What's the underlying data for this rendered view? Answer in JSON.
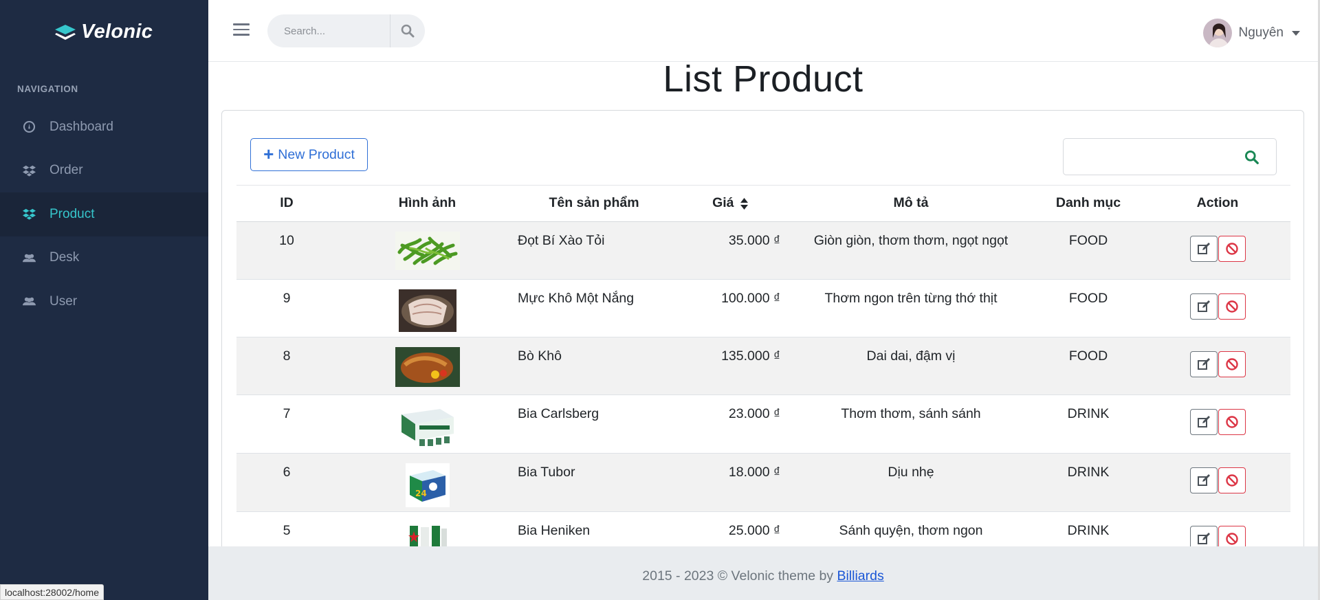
{
  "app": {
    "name": "Velonic"
  },
  "sidebar": {
    "nav_title": "NAVIGATION",
    "items": [
      {
        "label": "Dashboard",
        "icon": "dashboard-icon",
        "active": false
      },
      {
        "label": "Order",
        "icon": "dropbox-icon",
        "active": false
      },
      {
        "label": "Product",
        "icon": "dropbox-icon",
        "active": true
      },
      {
        "label": "Desk",
        "icon": "users-icon",
        "active": false
      },
      {
        "label": "User",
        "icon": "users-icon",
        "active": false
      }
    ]
  },
  "header": {
    "search_placeholder": "Search...",
    "user_name": "Nguyên"
  },
  "main": {
    "title": "List Product",
    "new_button": "New Product",
    "table_search_value": "",
    "columns": [
      "ID",
      "Hình ảnh",
      "Tên sản phẩm",
      "Giá",
      "Mô tả",
      "Danh mục",
      "Action"
    ],
    "rows": [
      {
        "id": "10",
        "image": "stir-fried greens",
        "name": "Đọt Bí Xào Tỏi",
        "price": "35.000 ₫",
        "desc": "Giòn giòn, thơm thơm, ngọt ngọt",
        "category": "FOOD"
      },
      {
        "id": "9",
        "image": "dried squid",
        "name": "Mực Khô Một Nắng",
        "price": "100.000 ₫",
        "desc": "Thơm ngon trên từng thớ thịt",
        "category": "FOOD"
      },
      {
        "id": "8",
        "image": "dried beef",
        "name": "Bò Khô",
        "price": "135.000 ₫",
        "desc": "Dai dai, đậm vị",
        "category": "FOOD"
      },
      {
        "id": "7",
        "image": "Carlsberg case",
        "name": "Bia Carlsberg",
        "price": "23.000 ₫",
        "desc": "Thơm thơm, sánh sánh",
        "category": "DRINK"
      },
      {
        "id": "6",
        "image": "Tuborg case",
        "name": "Bia Tubor",
        "price": "18.000 ₫",
        "desc": "Dịu nhẹ",
        "category": "DRINK"
      },
      {
        "id": "5",
        "image": "Heineken cans",
        "name": "Bia Heniken",
        "price": "25.000 ₫",
        "desc": "Sánh quyện, thơm ngon",
        "category": "DRINK"
      }
    ]
  },
  "footer": {
    "text": "2015 - 2023 © Velonic theme by ",
    "link": "Billiards"
  },
  "status_bar": {
    "url": "localhost:28002/home"
  },
  "colors": {
    "sidebar_bg": "#1e2b43",
    "accent": "#36c6cc",
    "primary": "#2f6fd6",
    "danger": "#dc3545",
    "search_icon": "#198754"
  }
}
